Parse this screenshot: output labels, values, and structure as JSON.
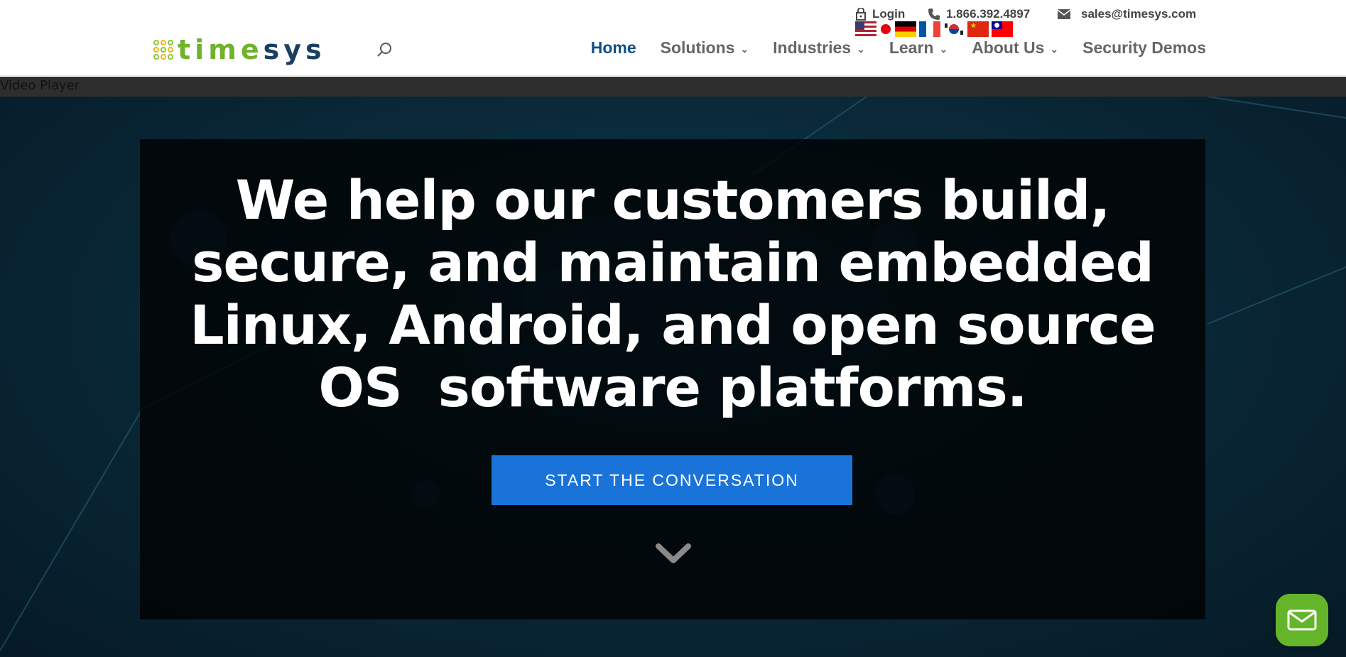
{
  "brand": {
    "logo_letters": [
      {
        "ch": "t",
        "tone": "green"
      },
      {
        "ch": "i",
        "tone": "green"
      },
      {
        "ch": "m",
        "tone": "green"
      },
      {
        "ch": "e",
        "tone": "green"
      },
      {
        "ch": "s",
        "tone": "blue"
      },
      {
        "ch": "y",
        "tone": "blue"
      },
      {
        "ch": "s",
        "tone": "blue"
      }
    ],
    "green": "#6fb22c",
    "blue": "#1a3f63"
  },
  "topbar": {
    "login_label": "Login",
    "phone": "1.866.392.4897",
    "email": "sales@timesys.com",
    "login_icon": "lock-icon",
    "phone_icon": "phone-icon",
    "email_icon": "envelope-icon"
  },
  "languages": [
    "us-flag",
    "japan-flag",
    "germany-flag",
    "france-flag",
    "korea-flag",
    "china-flag",
    "taiwan-flag"
  ],
  "nav": {
    "items": [
      {
        "label": "Home",
        "active": true,
        "dropdown": false
      },
      {
        "label": "Solutions",
        "active": false,
        "dropdown": true
      },
      {
        "label": "Industries",
        "active": false,
        "dropdown": true
      },
      {
        "label": "Learn",
        "active": false,
        "dropdown": true
      },
      {
        "label": "About Us",
        "active": false,
        "dropdown": true
      },
      {
        "label": "Security Demos",
        "active": false,
        "dropdown": false
      }
    ],
    "chevron": "⌄"
  },
  "video": {
    "label": "Video Player"
  },
  "hero": {
    "title_lines": [
      "We help our customers build,",
      "secure, and maintain embedded",
      "Linux, Android, and open source",
      "OS  software platforms."
    ],
    "cta_label": "START THE CONVERSATION",
    "cta_color": "#1a73d9"
  },
  "chat": {
    "icon": "envelope-icon",
    "color": "#64b52a"
  }
}
